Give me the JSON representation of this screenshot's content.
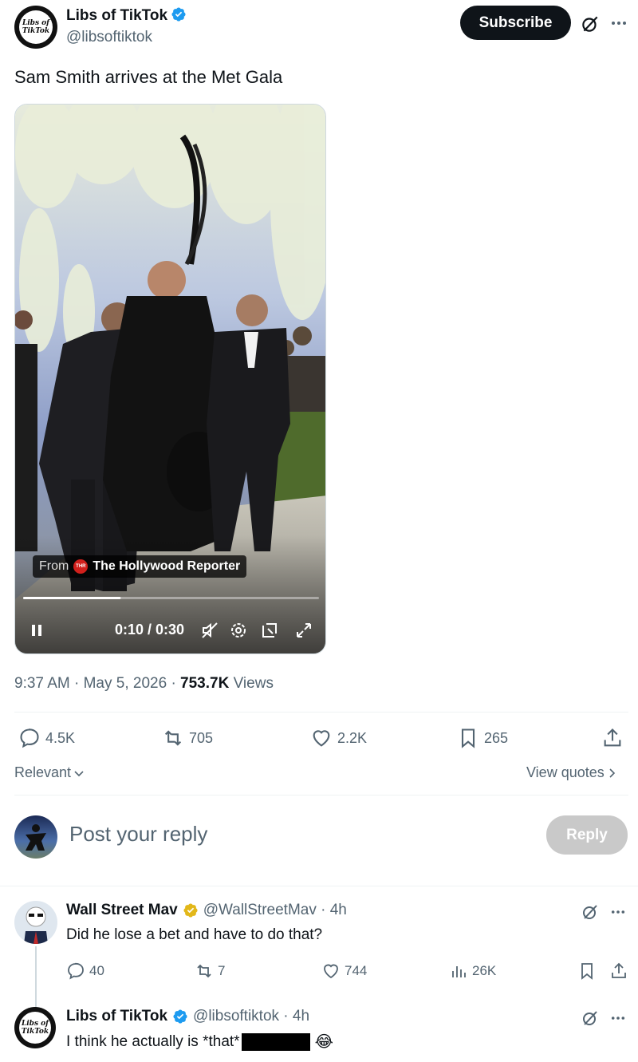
{
  "header": {
    "author_name": "Libs of TikTok",
    "author_handle": "@libsoftiktok",
    "avatar_text_1": "Libs of",
    "avatar_text_2": "TikTok",
    "subscribe_label": "Subscribe"
  },
  "tweet": {
    "text": "Sam Smith arrives at the Met Gala",
    "video": {
      "source_prefix": "From",
      "source_name": "The Hollywood Reporter",
      "source_badge": "THR",
      "time": "0:10 / 0:30",
      "progress": 0.33
    },
    "timestamp": "9:37 AM · May 5, 2026 · ",
    "views_count": "753.7K",
    "views_label": " Views",
    "stats": {
      "replies": "4.5K",
      "reposts": "705",
      "likes": "2.2K",
      "bookmarks": "265"
    },
    "relevant_label": "Relevant",
    "view_quotes_label": "View quotes"
  },
  "composer": {
    "placeholder": "Post your reply",
    "reply_label": "Reply"
  },
  "replies": [
    {
      "name": "Wall Street Mav",
      "handle": "@WallStreetMav · 4h",
      "text": "Did he lose a bet and have to do that?",
      "replies": "40",
      "reposts": "7",
      "likes": "744",
      "views": "26K"
    },
    {
      "name": "Libs of TikTok",
      "handle": "@libsoftiktok · 4h",
      "text": "I think he actually is *that*",
      "emoji": "😂"
    }
  ],
  "colors": {
    "verified_blue": "#1d9bf0",
    "verified_gold": "#e2b719",
    "text_primary": "#0f1419",
    "text_secondary": "#536471"
  }
}
